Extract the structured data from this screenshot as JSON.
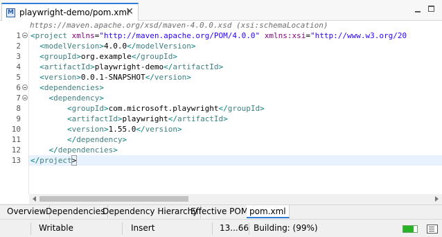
{
  "editor_tab": {
    "icon_letter": "M",
    "title": "playwright-demo/pom.xml",
    "close_glyph": "✕"
  },
  "window_controls": [
    "minimize-icon",
    "maximize-icon"
  ],
  "editor": {
    "schema_hint": "https://maven.apache.org/xsd/maven-4.0.0.xsd (xsi:schemaLocation)",
    "current_line": 13,
    "fold_lines": [
      1,
      6,
      7
    ],
    "lines": [
      {
        "n": "1",
        "tokens": [
          [
            "br",
            "<"
          ],
          [
            "tag",
            "project"
          ],
          [
            "txt",
            " "
          ],
          [
            "attr",
            "xmlns"
          ],
          [
            "txt",
            "="
          ],
          [
            "str",
            "\"http://maven.apache.org/POM/4.0.0\""
          ],
          [
            "txt",
            " "
          ],
          [
            "attr",
            "xmlns:xsi"
          ],
          [
            "txt",
            "="
          ],
          [
            "str",
            "\"http://www.w3.org/20"
          ]
        ]
      },
      {
        "n": "2",
        "tokens": [
          [
            "txt",
            "  "
          ],
          [
            "br",
            "<"
          ],
          [
            "tag",
            "modelVersion"
          ],
          [
            "br",
            ">"
          ],
          [
            "txt",
            "4.0.0"
          ],
          [
            "br",
            "</"
          ],
          [
            "tag",
            "modelVersion"
          ],
          [
            "br",
            ">"
          ]
        ]
      },
      {
        "n": "3",
        "tokens": [
          [
            "txt",
            "  "
          ],
          [
            "br",
            "<"
          ],
          [
            "tag",
            "groupId"
          ],
          [
            "br",
            ">"
          ],
          [
            "txt",
            "org.example"
          ],
          [
            "br",
            "</"
          ],
          [
            "tag",
            "groupId"
          ],
          [
            "br",
            ">"
          ]
        ]
      },
      {
        "n": "4",
        "tokens": [
          [
            "txt",
            "  "
          ],
          [
            "br",
            "<"
          ],
          [
            "tag",
            "artifactId"
          ],
          [
            "br",
            ">"
          ],
          [
            "txt",
            "playwright-demo"
          ],
          [
            "br",
            "</"
          ],
          [
            "tag",
            "artifactId"
          ],
          [
            "br",
            ">"
          ]
        ]
      },
      {
        "n": "5",
        "tokens": [
          [
            "txt",
            "  "
          ],
          [
            "br",
            "<"
          ],
          [
            "tag",
            "version"
          ],
          [
            "br",
            ">"
          ],
          [
            "txt",
            "0.0.1-SNAPSHOT"
          ],
          [
            "br",
            "</"
          ],
          [
            "tag",
            "version"
          ],
          [
            "br",
            ">"
          ]
        ]
      },
      {
        "n": "6",
        "tokens": [
          [
            "txt",
            "  "
          ],
          [
            "br",
            "<"
          ],
          [
            "tag",
            "dependencies"
          ],
          [
            "br",
            ">"
          ]
        ]
      },
      {
        "n": "7",
        "tokens": [
          [
            "txt",
            "    "
          ],
          [
            "br",
            "<"
          ],
          [
            "tag",
            "dependency"
          ],
          [
            "br",
            ">"
          ]
        ]
      },
      {
        "n": "8",
        "tokens": [
          [
            "txt",
            "        "
          ],
          [
            "br",
            "<"
          ],
          [
            "tag",
            "groupId"
          ],
          [
            "br",
            ">"
          ],
          [
            "txt",
            "com.microsoft.playwright"
          ],
          [
            "br",
            "</"
          ],
          [
            "tag",
            "groupId"
          ],
          [
            "br",
            ">"
          ]
        ]
      },
      {
        "n": "9",
        "tokens": [
          [
            "txt",
            "        "
          ],
          [
            "br",
            "<"
          ],
          [
            "tag",
            "artifactId"
          ],
          [
            "br",
            ">"
          ],
          [
            "txt",
            "playwright"
          ],
          [
            "br",
            "</"
          ],
          [
            "tag",
            "artifactId"
          ],
          [
            "br",
            ">"
          ]
        ]
      },
      {
        "n": "10",
        "tokens": [
          [
            "txt",
            "        "
          ],
          [
            "br",
            "<"
          ],
          [
            "tag",
            "version"
          ],
          [
            "br",
            ">"
          ],
          [
            "txt",
            "1.55.0"
          ],
          [
            "br",
            "</"
          ],
          [
            "tag",
            "version"
          ],
          [
            "br",
            ">"
          ]
        ]
      },
      {
        "n": "11",
        "tokens": [
          [
            "txt",
            "        "
          ],
          [
            "br",
            "</"
          ],
          [
            "tag",
            "dependency"
          ],
          [
            "br",
            ">"
          ]
        ]
      },
      {
        "n": "12",
        "tokens": [
          [
            "txt",
            "    "
          ],
          [
            "br",
            "</"
          ],
          [
            "tag",
            "dependencies"
          ],
          [
            "br",
            ">"
          ]
        ]
      },
      {
        "n": "13",
        "tokens": [
          [
            "br",
            "<"
          ],
          [
            "br",
            "/"
          ],
          [
            "tag",
            "project"
          ],
          [
            "bm",
            ">"
          ]
        ]
      }
    ]
  },
  "page_tabs": [
    {
      "label": "Overview",
      "active": false
    },
    {
      "label": "Dependencies",
      "active": false
    },
    {
      "label": "Dependency Hierarchy",
      "active": false
    },
    {
      "label": "Effective POM",
      "active": false
    },
    {
      "label": "pom.xml",
      "active": true
    }
  ],
  "status_bar": {
    "mode": "Writable",
    "insert_mode": "Insert",
    "position": "13...66",
    "task": "Building: (99%)",
    "progress_fraction": 0.75
  },
  "colors": {
    "accent": "#2e7dd7",
    "xml_tag": "#3f7f7f",
    "xml_attr": "#7f007f",
    "xml_string": "#2a00ff",
    "current_line": "#e8f2fe",
    "progress": "#26b426"
  }
}
